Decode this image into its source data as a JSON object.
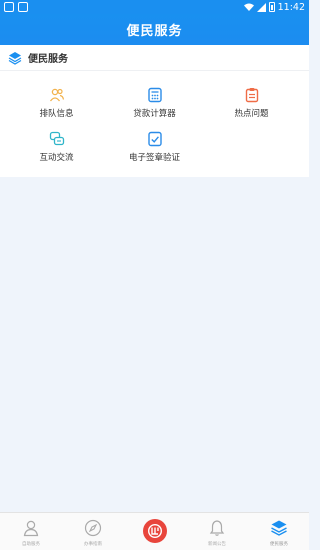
{
  "status_bar": {
    "time": "11:42"
  },
  "title_bar": {
    "title": "便民服务"
  },
  "section": {
    "title": "便民服务"
  },
  "services": [
    {
      "label": "排队信息",
      "icon": "people-icon"
    },
    {
      "label": "贷款计算器",
      "icon": "calculator-icon"
    },
    {
      "label": "热点问题",
      "icon": "clipboard-icon"
    },
    {
      "label": "互动交流",
      "icon": "chat-icon"
    },
    {
      "label": "电子签章验证",
      "icon": "seal-check-icon"
    }
  ],
  "tabs": [
    {
      "label": "自助服务",
      "icon": "user-icon"
    },
    {
      "label": "办事指南",
      "icon": "compass-icon"
    },
    {
      "label": "",
      "icon": "center-logo-icon"
    },
    {
      "label": "新闻公告",
      "icon": "bell-icon"
    },
    {
      "label": "便民服务",
      "icon": "layers-icon"
    }
  ],
  "colors": {
    "primary": "#1a8ff0",
    "accent_red": "#e8453c",
    "background": "#eff4fb"
  }
}
